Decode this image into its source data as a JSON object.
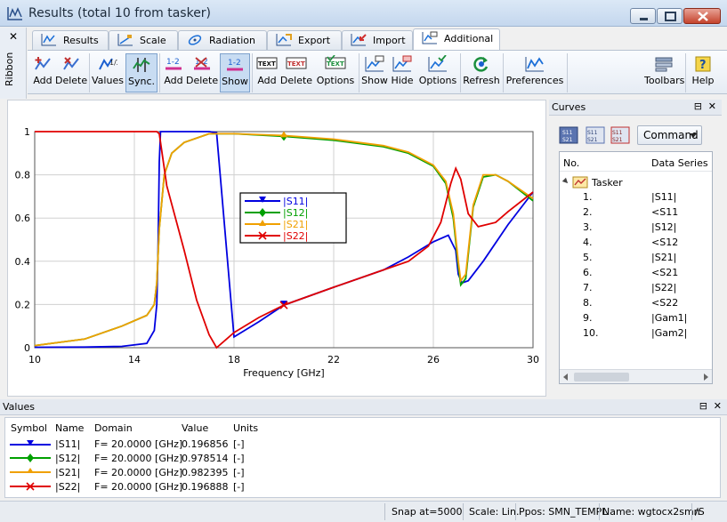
{
  "window": {
    "title": "Results (total 10 from tasker)"
  },
  "ribbon": {
    "label": "Ribbon",
    "tabs": [
      {
        "label": "Results",
        "icon": "results-icon"
      },
      {
        "label": "Scale",
        "icon": "scale-icon"
      },
      {
        "label": "Radiation",
        "icon": "radiation-icon"
      },
      {
        "label": "Export",
        "icon": "export-icon"
      },
      {
        "label": "Import",
        "icon": "import-icon"
      },
      {
        "label": "Additional",
        "icon": "additional-icon",
        "active": true
      }
    ],
    "buttons": [
      {
        "label": "Add",
        "icon": "add-curve-icon"
      },
      {
        "label": "Delete",
        "icon": "delete-curve-icon"
      },
      {
        "label": "Values",
        "icon": "values-icon"
      },
      {
        "label": "Sync.",
        "icon": "sync-icon",
        "active": true
      },
      {
        "label": "Add",
        "icon": "add-marker-icon"
      },
      {
        "label": "Delete",
        "icon": "delete-marker-icon"
      },
      {
        "label": "Show",
        "icon": "show-marker-icon",
        "active": true
      },
      {
        "label": "Add",
        "icon": "add-text-icon"
      },
      {
        "label": "Delete",
        "icon": "delete-text-icon"
      },
      {
        "label": "Options",
        "icon": "text-options-icon"
      },
      {
        "label": "Show",
        "icon": "show-legend-icon"
      },
      {
        "label": "Hide",
        "icon": "hide-legend-icon"
      },
      {
        "label": "Options",
        "icon": "legend-options-icon"
      },
      {
        "label": "Refresh",
        "icon": "refresh-icon"
      },
      {
        "label": "Preferences",
        "icon": "preferences-icon"
      },
      {
        "label": "Toolbars",
        "icon": "toolbars-icon"
      },
      {
        "label": "Help",
        "icon": "help-icon"
      }
    ]
  },
  "chart_data": {
    "type": "line",
    "title": "",
    "xlabel": "Frequency [GHz]",
    "ylabel": "",
    "xlim": [
      10,
      30
    ],
    "ylim": [
      0,
      1
    ],
    "xticks": [
      "10",
      "14",
      "18",
      "22",
      "26",
      "30"
    ],
    "yticks": [
      "0",
      "0.2",
      "0.4",
      "0.6",
      "0.8",
      "1"
    ],
    "grid": true,
    "legend_position": "center",
    "marker_x": 20,
    "series": [
      {
        "name": "|S11|",
        "color": "#0000e0",
        "marker": "triangle-down",
        "points": [
          [
            10,
            0.002
          ],
          [
            12,
            0.003
          ],
          [
            13.5,
            0.006
          ],
          [
            14.5,
            0.02
          ],
          [
            14.8,
            0.08
          ],
          [
            14.9,
            0.2
          ],
          [
            14.95,
            0.45
          ],
          [
            15.0,
            0.86
          ],
          [
            15.05,
            1.0
          ],
          [
            16,
            1.0
          ],
          [
            17,
            1.0
          ],
          [
            17.3,
            0.995
          ],
          [
            18,
            0.05
          ],
          [
            19,
            0.12
          ],
          [
            20,
            0.197
          ],
          [
            22,
            0.28
          ],
          [
            24,
            0.36
          ],
          [
            25,
            0.42
          ],
          [
            26,
            0.49
          ],
          [
            26.6,
            0.52
          ],
          [
            26.9,
            0.45
          ],
          [
            27.0,
            0.34
          ],
          [
            27.15,
            0.3
          ],
          [
            27.4,
            0.31
          ],
          [
            28,
            0.4
          ],
          [
            29,
            0.57
          ],
          [
            30,
            0.72
          ]
        ]
      },
      {
        "name": "|S12|",
        "color": "#00a000",
        "marker": "diamond",
        "points": [
          [
            10,
            0.01
          ],
          [
            12,
            0.04
          ],
          [
            13.5,
            0.1
          ],
          [
            14.5,
            0.15
          ],
          [
            14.8,
            0.2
          ],
          [
            14.9,
            0.3
          ],
          [
            15.0,
            0.55
          ],
          [
            15.2,
            0.8
          ],
          [
            15.5,
            0.9
          ],
          [
            16,
            0.95
          ],
          [
            17,
            0.99
          ],
          [
            18,
            0.99
          ],
          [
            20,
            0.978
          ],
          [
            22,
            0.96
          ],
          [
            24,
            0.93
          ],
          [
            25,
            0.9
          ],
          [
            26,
            0.84
          ],
          [
            26.5,
            0.76
          ],
          [
            26.8,
            0.6
          ],
          [
            27.0,
            0.38
          ],
          [
            27.1,
            0.29
          ],
          [
            27.3,
            0.32
          ],
          [
            27.6,
            0.65
          ],
          [
            28,
            0.79
          ],
          [
            28.5,
            0.8
          ],
          [
            29,
            0.77
          ],
          [
            30,
            0.68
          ]
        ]
      },
      {
        "name": "|S21|",
        "color": "#f0a000",
        "marker": "triangle-up",
        "points": [
          [
            10,
            0.01
          ],
          [
            12,
            0.04
          ],
          [
            13.5,
            0.1
          ],
          [
            14.5,
            0.15
          ],
          [
            14.8,
            0.2
          ],
          [
            14.9,
            0.3
          ],
          [
            15.0,
            0.55
          ],
          [
            15.2,
            0.8
          ],
          [
            15.5,
            0.9
          ],
          [
            16,
            0.95
          ],
          [
            17,
            0.99
          ],
          [
            18,
            0.99
          ],
          [
            20,
            0.982
          ],
          [
            22,
            0.965
          ],
          [
            24,
            0.935
          ],
          [
            25,
            0.905
          ],
          [
            26,
            0.845
          ],
          [
            26.5,
            0.77
          ],
          [
            26.8,
            0.62
          ],
          [
            27.0,
            0.4
          ],
          [
            27.1,
            0.31
          ],
          [
            27.3,
            0.34
          ],
          [
            27.6,
            0.66
          ],
          [
            28,
            0.8
          ],
          [
            28.5,
            0.8
          ],
          [
            29,
            0.77
          ],
          [
            30,
            0.69
          ]
        ]
      },
      {
        "name": "|S22|",
        "color": "#e00000",
        "marker": "x",
        "points": [
          [
            10,
            1.0
          ],
          [
            12,
            1.0
          ],
          [
            14,
            1.0
          ],
          [
            14.9,
            1.0
          ],
          [
            15.0,
            0.99
          ],
          [
            15.3,
            0.75
          ],
          [
            16,
            0.45
          ],
          [
            16.5,
            0.22
          ],
          [
            17,
            0.06
          ],
          [
            17.3,
            0.0
          ],
          [
            18,
            0.07
          ],
          [
            19,
            0.14
          ],
          [
            20,
            0.197
          ],
          [
            22,
            0.28
          ],
          [
            24,
            0.36
          ],
          [
            25,
            0.4
          ],
          [
            25.8,
            0.47
          ],
          [
            26.3,
            0.58
          ],
          [
            26.7,
            0.76
          ],
          [
            26.9,
            0.83
          ],
          [
            27.1,
            0.78
          ],
          [
            27.4,
            0.62
          ],
          [
            27.8,
            0.56
          ],
          [
            28.5,
            0.58
          ],
          [
            29,
            0.63
          ],
          [
            30,
            0.72
          ]
        ]
      }
    ]
  },
  "curves_panel": {
    "title": "Curves",
    "command_label": "Command",
    "columns": {
      "no": "No.",
      "series": "Data Series"
    },
    "root": "Tasker",
    "rows": [
      {
        "no": "1.",
        "series": "|S11|"
      },
      {
        "no": "2.",
        "series": "<S11"
      },
      {
        "no": "3.",
        "series": "|S12|"
      },
      {
        "no": "4.",
        "series": "<S12"
      },
      {
        "no": "5.",
        "series": "|S21|"
      },
      {
        "no": "6.",
        "series": "<S21"
      },
      {
        "no": "7.",
        "series": "|S22|"
      },
      {
        "no": "8.",
        "series": "<S22"
      },
      {
        "no": "9.",
        "series": "|Gam1|"
      },
      {
        "no": "10.",
        "series": "|Gam2|"
      }
    ]
  },
  "values_panel": {
    "title": "Values",
    "columns": {
      "symbol": "Symbol",
      "name": "Name",
      "domain": "Domain",
      "value": "Value",
      "units": "Units"
    },
    "rows": [
      {
        "name": "|S11|",
        "domain": "F= 20.0000 [GHz]",
        "value": "0.196856",
        "units": "[-]",
        "color": "#0000e0",
        "marker": "triangle-down"
      },
      {
        "name": "|S12|",
        "domain": "F= 20.0000 [GHz]",
        "value": "0.978514",
        "units": "[-]",
        "color": "#00a000",
        "marker": "diamond"
      },
      {
        "name": "|S21|",
        "domain": "F= 20.0000 [GHz]",
        "value": "0.982395",
        "units": "[-]",
        "color": "#f0a000",
        "marker": "triangle-up"
      },
      {
        "name": "|S22|",
        "domain": "F= 20.0000 [GHz]",
        "value": "0.196888",
        "units": "[-]",
        "color": "#e00000",
        "marker": "x"
      }
    ]
  },
  "statusbar": {
    "snap": "Snap at=5000",
    "scale": "Scale: Lin.",
    "ppos": "Ppos: SMN_TEMPL",
    "name": "Name: wgtocx2smn",
    "extra": "/S"
  }
}
